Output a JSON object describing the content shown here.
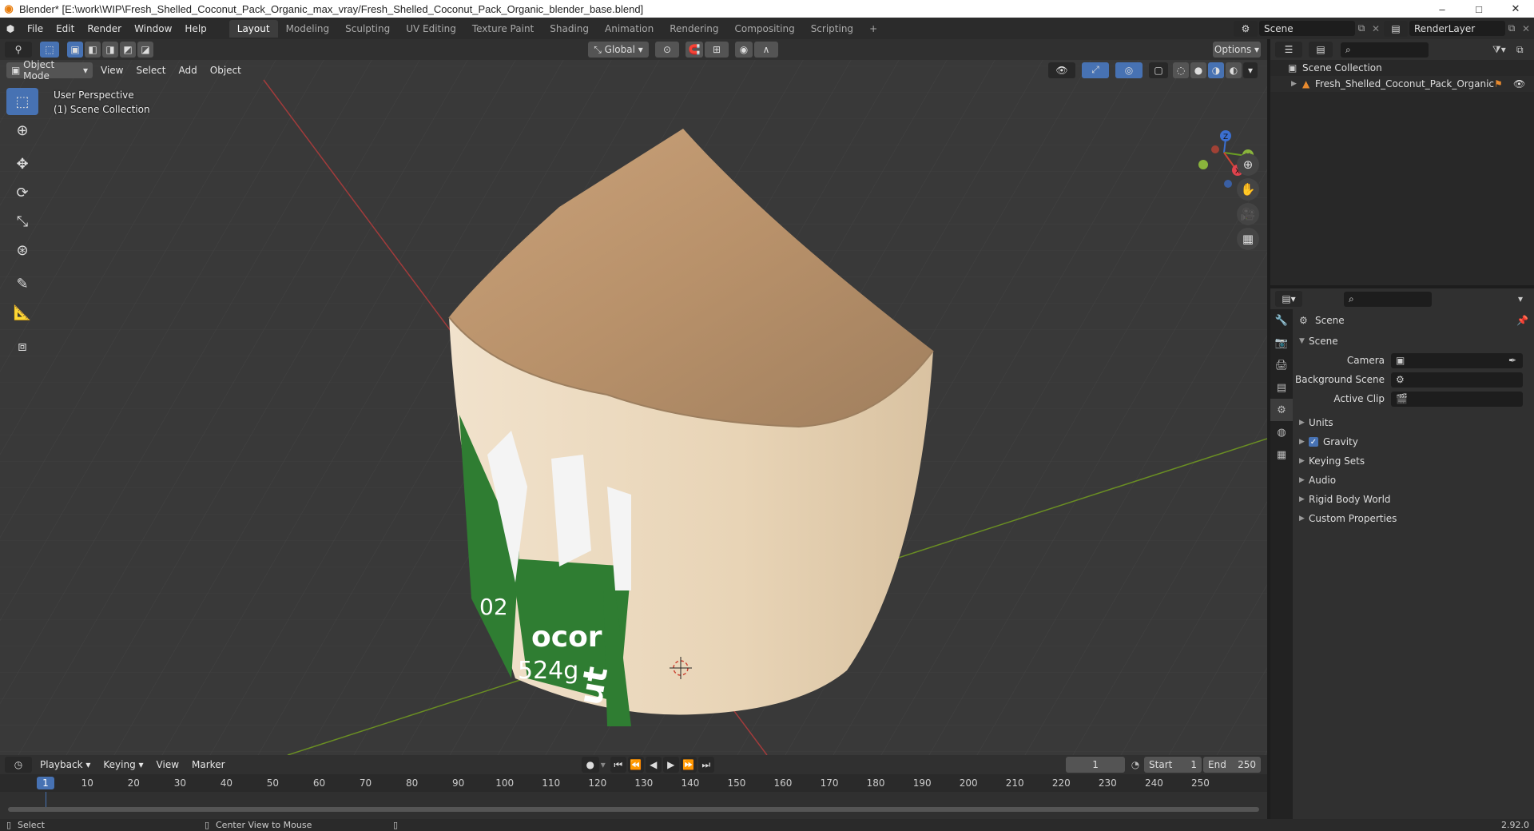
{
  "window": {
    "title": "Blender* [E:\\work\\WIP\\Fresh_Shelled_Coconut_Pack_Organic_max_vray/Fresh_Shelled_Coconut_Pack_Organic_blender_base.blend]",
    "minimize": "–",
    "maximize": "□",
    "close": "✕"
  },
  "menubar": {
    "items": [
      "File",
      "Edit",
      "Render",
      "Window",
      "Help"
    ],
    "workspaces": [
      "Layout",
      "Modeling",
      "Sculpting",
      "UV Editing",
      "Texture Paint",
      "Shading",
      "Animation",
      "Rendering",
      "Compositing",
      "Scripting"
    ],
    "add_tab": "+",
    "scene": "Scene",
    "render_layer": "RenderLayer"
  },
  "viewport": {
    "mode": "Object Mode",
    "menus": [
      "View",
      "Select",
      "Add",
      "Object"
    ],
    "orientation": "Global",
    "options": "Options",
    "info_line1": "User Perspective",
    "info_line2": "(1) Scene Collection",
    "axes": {
      "x": "X",
      "y": "Y",
      "z": "Z"
    },
    "label_text": {
      "t1": "ocor",
      "t2": "524g",
      "t3": "ut",
      "t4": "02"
    }
  },
  "timeline": {
    "menus": [
      "Playback",
      "Keying",
      "View",
      "Marker"
    ],
    "current_frame": "1",
    "start_label": "Start",
    "start": "1",
    "end_label": "End",
    "end": "250",
    "ticks": [
      "1",
      "10",
      "20",
      "30",
      "40",
      "50",
      "60",
      "70",
      "80",
      "90",
      "100",
      "110",
      "120",
      "130",
      "140",
      "150",
      "160",
      "170",
      "180",
      "190",
      "200",
      "210",
      "220",
      "230",
      "240",
      "250"
    ]
  },
  "statusbar": {
    "left": "Select",
    "middle": "Center View to Mouse",
    "version": "2.92.0"
  },
  "outliner": {
    "root": "Scene Collection",
    "object": "Fresh_Shelled_Coconut_Pack_Organic"
  },
  "properties": {
    "context": "Scene",
    "panel": "Scene",
    "fields": [
      {
        "label": "Camera",
        "value": ""
      },
      {
        "label": "Background Scene",
        "value": ""
      },
      {
        "label": "Active Clip",
        "value": ""
      }
    ],
    "subpanels": [
      "Units",
      "Gravity",
      "Keying Sets",
      "Audio",
      "Rigid Body World",
      "Custom Properties"
    ],
    "gravity_checked": true
  },
  "colors": {
    "accent": "#4772b3",
    "axis_x": "#a23b3b",
    "axis_y": "#6a8e23",
    "label_green": "#2f7d32"
  }
}
